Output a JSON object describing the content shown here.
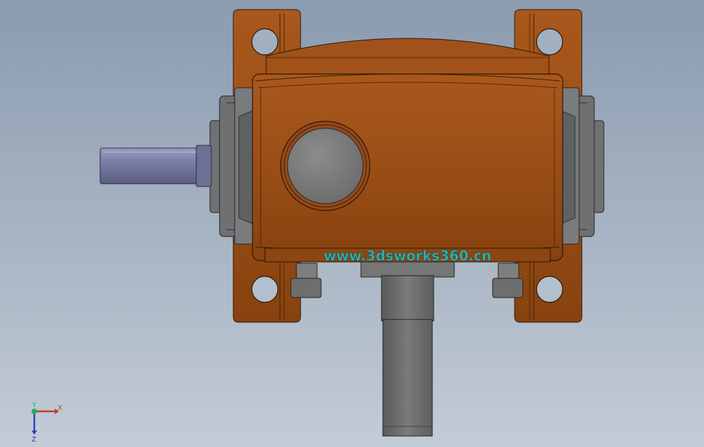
{
  "viewport": {
    "background_top": "#8b9bb0",
    "background_bottom": "#c3ccd6"
  },
  "model": {
    "part": "worm-gearbox",
    "housing_color": "#9a4e16",
    "input_shaft_color": "#7a7ea6",
    "output_shaft_color": "#6b6b6b",
    "bearing_cap_color": "#6f7072",
    "inspection_cover_color": "#7d7d7d",
    "watermark_text": "www.3dsworks360.cn",
    "watermark_color": "#2fb3b8"
  },
  "triad": {
    "x_label": "X",
    "y_label": "Y",
    "z_label": "Z",
    "x_color": "#c0392b",
    "y_color": "#27ae60",
    "z_color": "#2e3fbf"
  }
}
